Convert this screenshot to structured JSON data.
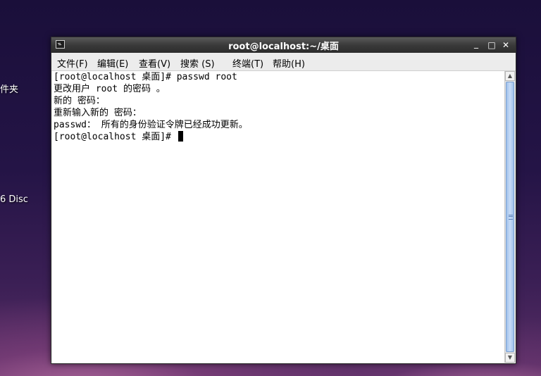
{
  "desktop": {
    "icon_labels": [
      "件夹",
      "6 Disc"
    ]
  },
  "window": {
    "title": "root@localhost:~/桌面",
    "controls": {
      "minimize": "_",
      "maximize": "□",
      "close": "✕"
    }
  },
  "menubar": {
    "items": [
      {
        "label": "文件(F)"
      },
      {
        "label": "编辑(E)"
      },
      {
        "label": "查看(V)"
      },
      {
        "label": "搜索 (S)"
      },
      {
        "label": "终端(T)"
      },
      {
        "label": "帮助(H)"
      }
    ]
  },
  "terminal": {
    "lines": [
      "[root@localhost 桌面]# passwd root",
      "更改用户 root 的密码 。",
      "新的 密码：",
      "重新输入新的 密码：",
      "passwd： 所有的身份验证令牌已经成功更新。",
      "[root@localhost 桌面]# "
    ]
  },
  "scrollbar": {
    "up": "▲",
    "down": "▼"
  }
}
